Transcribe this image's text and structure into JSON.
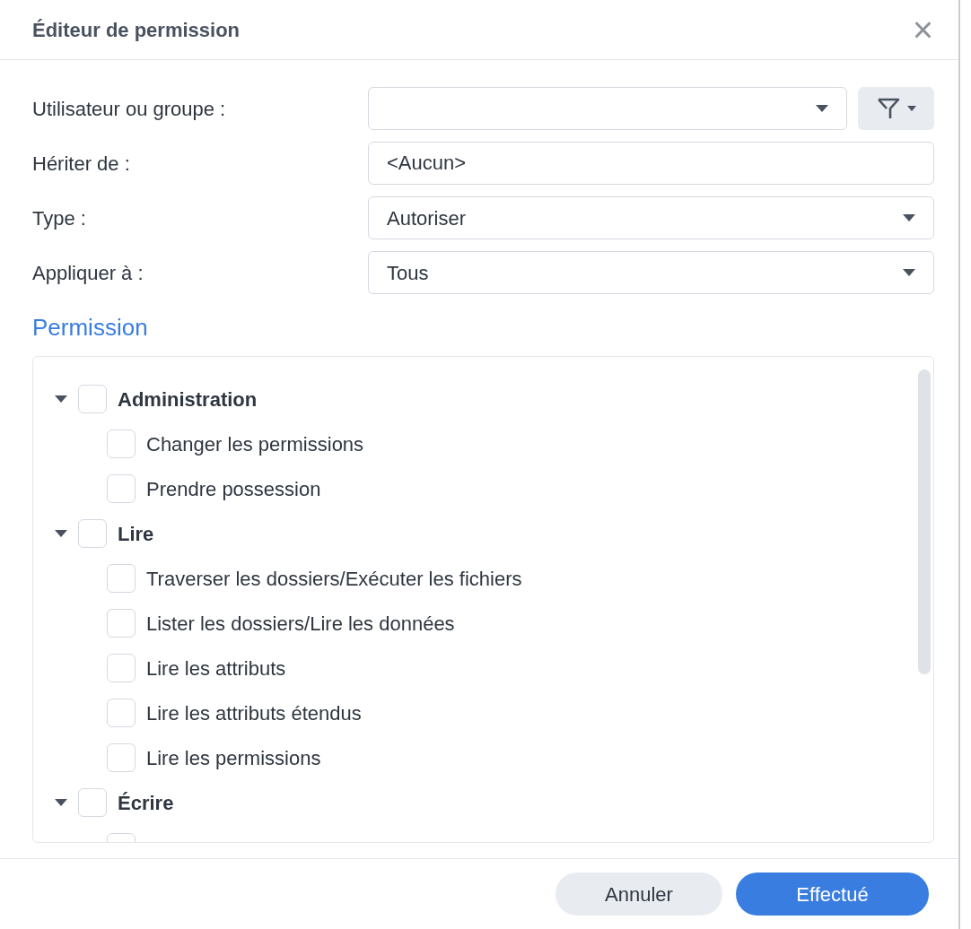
{
  "window": {
    "title": "Éditeur de permission",
    "close": "×"
  },
  "form": [
    {
      "kind": "combo",
      "label": "Utilisateur ou groupe :"
    },
    {
      "kind": "text",
      "label": "Hériter de :",
      "value": "<Aucun>"
    },
    {
      "kind": "select",
      "label": "Type :",
      "value": "Autoriser"
    },
    {
      "kind": "select",
      "label": "Appliquer à :",
      "value": "Tous"
    }
  ],
  "section_title": "Permission",
  "tree": [
    {
      "label": "Administration",
      "checked": false,
      "expanded": true,
      "children": [
        {
          "label": "Changer les permissions",
          "checked": false
        },
        {
          "label": "Prendre possession",
          "checked": false
        }
      ]
    },
    {
      "label": "Lire",
      "checked": false,
      "expanded": true,
      "children": [
        {
          "label": "Traverser les dossiers/Exécuter les fichiers",
          "checked": false
        },
        {
          "label": "Lister les dossiers/Lire les données",
          "checked": false
        },
        {
          "label": "Lire les attributs",
          "checked": false
        },
        {
          "label": "Lire les attributs étendus",
          "checked": false
        },
        {
          "label": "Lire les permissions",
          "checked": false
        }
      ]
    },
    {
      "label": "Écrire",
      "checked": false,
      "expanded": true,
      "children": [
        {
          "checked": false
        }
      ]
    }
  ],
  "buttons": [
    {
      "label": "Annuler",
      "kind": "secondary"
    },
    {
      "label": "Effectué",
      "kind": "primary"
    }
  ]
}
